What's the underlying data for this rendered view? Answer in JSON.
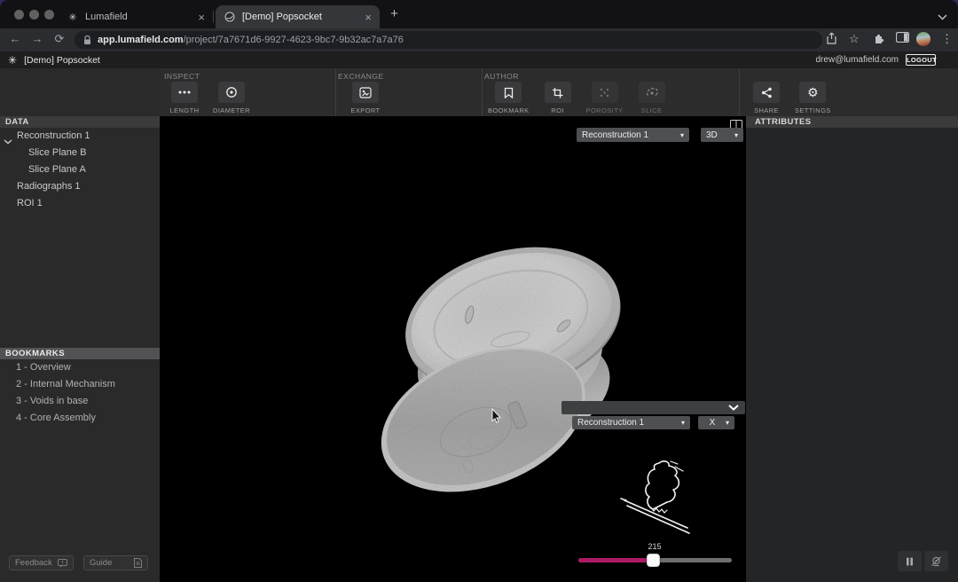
{
  "browser": {
    "tabs": [
      {
        "title": "Lumafield"
      },
      {
        "title": "[Demo] Popsocket"
      }
    ],
    "url": {
      "host": "app.lumafield.com",
      "path": "/project/7a7671d6-9927-4623-9bc7-9b32ac7a7a76"
    }
  },
  "icons": {
    "back": "←",
    "forward": "→",
    "reload": "⟳",
    "star": "☆",
    "kebab": "⋮",
    "new_tab": "+",
    "close": "×",
    "caret": "▾",
    "gear": "⚙",
    "logo": "✳"
  },
  "app_header": {
    "title": "[Demo] Popsocket",
    "user_email": "drew@lumafield.com",
    "logout_label": "LOGOUT"
  },
  "toolbar": {
    "inspect": {
      "label": "INSPECT",
      "length_label": "LENGTH",
      "diameter_label": "DIAMETER"
    },
    "exchange": {
      "label": "EXCHANGE",
      "export_label": "EXPORT"
    },
    "author": {
      "label": "AUTHOR",
      "bookmark_label": "BOOKMARK",
      "roi_label": "ROI",
      "porosity_label": "POROSITY",
      "slice_label": "SLICE"
    },
    "share_label": "SHARE",
    "settings_label": "SETTINGS"
  },
  "sidebar": {
    "data_header": "DATA",
    "tree": [
      {
        "label": "Reconstruction 1",
        "expanded": true
      },
      {
        "label": "Slice Plane B"
      },
      {
        "label": "Slice Plane A"
      },
      {
        "label": "Radiographs 1"
      },
      {
        "label": "ROI 1"
      }
    ],
    "bookmarks_header": "BOOKMARKS",
    "bookmarks": [
      {
        "label": "1 - Overview"
      },
      {
        "label": "2 - Internal Mechanism"
      },
      {
        "label": "3 - Voids in base"
      },
      {
        "label": "4 - Core Assembly"
      }
    ],
    "feedback_label": "Feedback",
    "guide_label": "Guide"
  },
  "viewport": {
    "reconstruction_select": "Reconstruction 1",
    "view_mode_select": "3D",
    "slice_reconstruction_select": "Reconstruction 1",
    "slice_axis_select": "X",
    "slice_slider": {
      "value": "215"
    }
  },
  "attributes_panel": {
    "header": "ATTRIBUTES"
  },
  "colors": {
    "accent_pink": "#ab1b66",
    "viewport_bg": "#000000"
  }
}
